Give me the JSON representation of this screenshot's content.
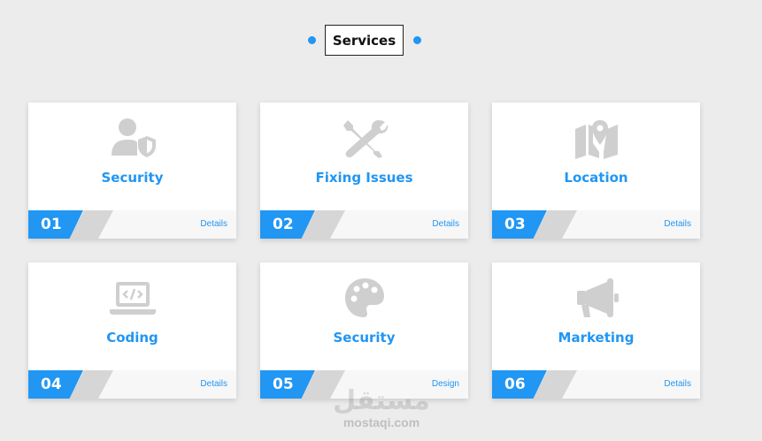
{
  "header": {
    "title": "Services"
  },
  "cards": [
    {
      "title": "Security",
      "number": "01",
      "link": "Details",
      "icon": "user-shield-icon"
    },
    {
      "title": "Fixing Issues",
      "number": "02",
      "link": "Details",
      "icon": "tools-icon"
    },
    {
      "title": "Location",
      "number": "03",
      "link": "Details",
      "icon": "map-marker-icon"
    },
    {
      "title": "Coding",
      "number": "04",
      "link": "Details",
      "icon": "laptop-code-icon"
    },
    {
      "title": "Security",
      "number": "05",
      "link": "Design",
      "icon": "palette-icon"
    },
    {
      "title": "Marketing",
      "number": "06",
      "link": "Details",
      "icon": "megaphone-icon"
    }
  ],
  "watermark": {
    "logo": "مستقل",
    "text": "mostaqi.com"
  },
  "colors": {
    "accent": "#2196f3",
    "icon": "#cfcfcf",
    "background": "#ececec"
  }
}
